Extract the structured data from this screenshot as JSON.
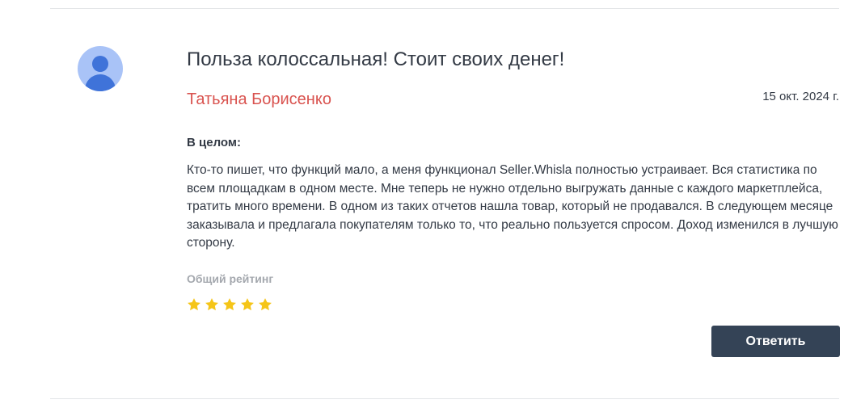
{
  "review": {
    "title": "Польза колоссальная! Стоит своих денег!",
    "author": "Татьяна Борисенко",
    "date": "15 окт. 2024 г.",
    "section_label": "В целом:",
    "text": "Кто-то пишет, что функций мало, а меня функционал Seller.Whisla полностью устраивает. Вся статистика по всем площадкам в одном месте. Мне теперь не нужно отдельно выгружать данные с каждого маркетплейса, тратить много времени. В одном из таких отчетов нашла товар, который не продавался. В следующем месяце заказывала и предлагала покупателям только то, что реально пользуется спросом. Доход изменился в лучшую сторону.",
    "rating_label": "Общий рейтинг",
    "rating": 5,
    "rating_max": 5,
    "reply_label": "Ответить"
  },
  "colors": {
    "author": "#d9534f",
    "star": "#f5c518",
    "button_bg": "#344356",
    "avatar_bg": "#a9c3f7",
    "avatar_fg": "#3f73d9"
  },
  "icons": {
    "avatar": "user-avatar-icon",
    "star": "star-icon"
  }
}
